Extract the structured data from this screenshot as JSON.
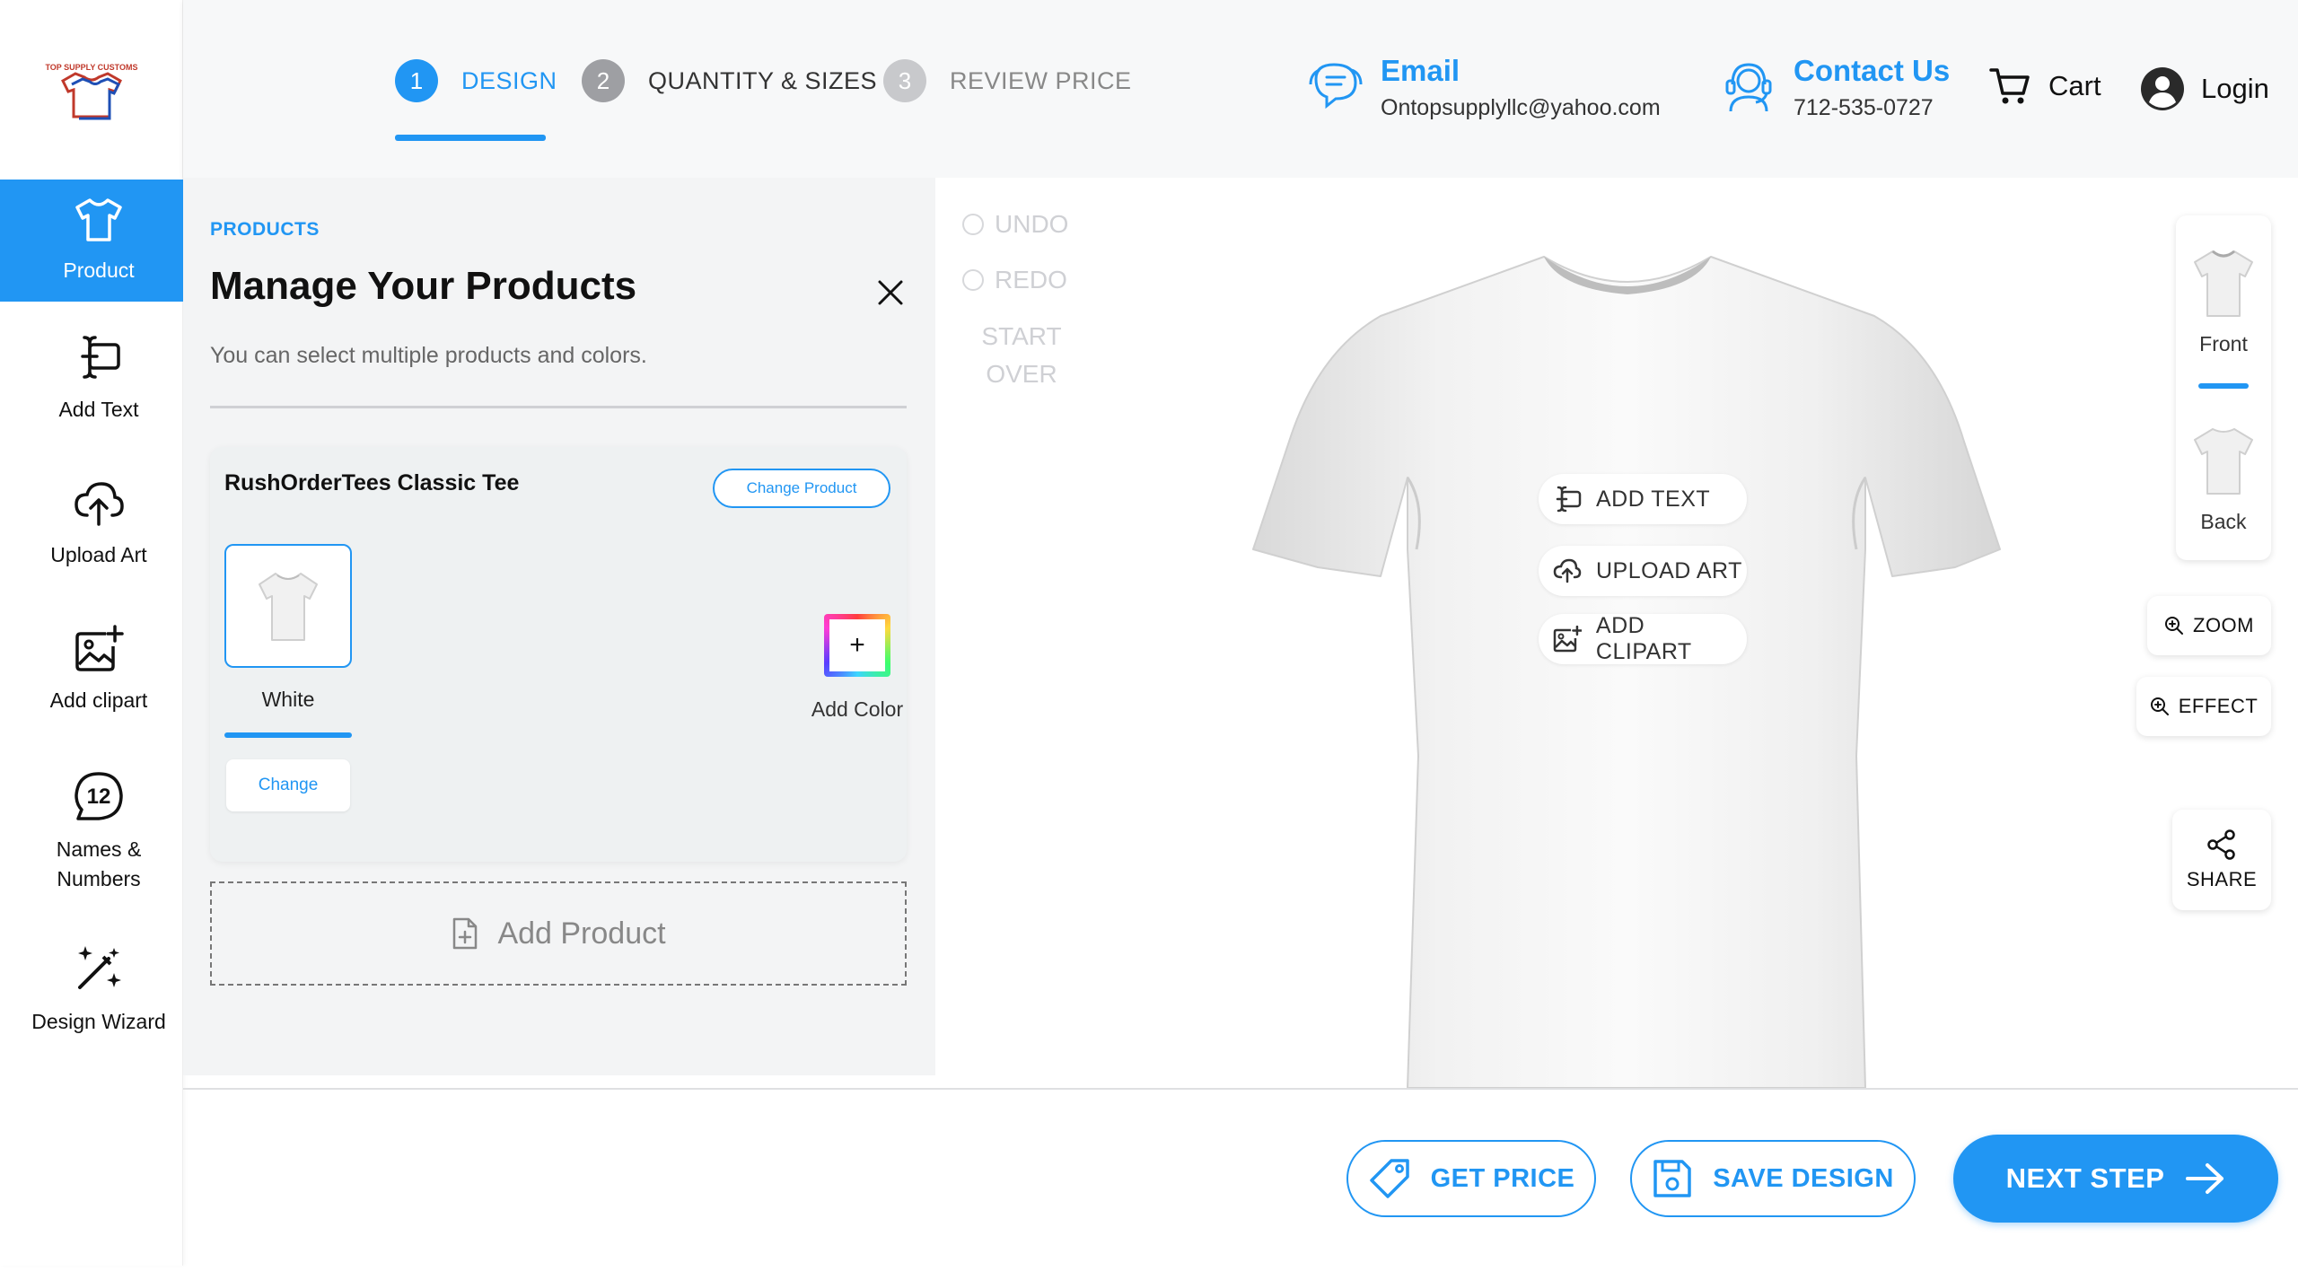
{
  "brand": {
    "logo_text": "TOP SUPPLY CUSTOMS"
  },
  "steps": [
    {
      "num": "1",
      "label": "DESIGN",
      "state": "active"
    },
    {
      "num": "2",
      "label": "QUANTITY & SIZES",
      "state": "inactive"
    },
    {
      "num": "3",
      "label": "REVIEW PRICE",
      "state": "inactive"
    }
  ],
  "header": {
    "email": {
      "title": "Email",
      "value": "Ontopsupplyllc@yahoo.com",
      "icon": "chat-support-icon"
    },
    "contact": {
      "title": "Contact Us",
      "value": "712-535-0727",
      "icon": "headset-icon"
    },
    "cart_label": "Cart",
    "login_label": "Login"
  },
  "sidebar": {
    "items": [
      {
        "label": "Product",
        "icon": "tshirt-icon",
        "active": true
      },
      {
        "label": "Add Text",
        "icon": "text-cursor-icon"
      },
      {
        "label": "Upload Art",
        "icon": "cloud-upload-icon"
      },
      {
        "label": "Add clipart",
        "icon": "image-add-icon"
      },
      {
        "label": "Names & Numbers",
        "icon": "number-badge-icon",
        "badge": "12"
      },
      {
        "label": "Design Wizard",
        "icon": "magic-wand-icon"
      }
    ]
  },
  "panel": {
    "kicker": "PRODUCTS",
    "title": "Manage Your Products",
    "hint": "You can select multiple products and colors.",
    "product": {
      "name": "RushOrderTees Classic Tee",
      "change_product_label": "Change Product",
      "color_name": "White",
      "change_label": "Change",
      "add_color_label": "Add Color",
      "add_color_symbol": "+"
    },
    "add_product_label": "Add Product"
  },
  "history": {
    "undo": "UNDO",
    "redo": "REDO",
    "start_over": "START OVER"
  },
  "overlay": {
    "add_text": "ADD TEXT",
    "upload_art": "UPLOAD ART",
    "add_clipart": "ADD CLIPART"
  },
  "views": {
    "front": "Front",
    "back": "Back",
    "zoom": "ZOOM",
    "effect": "EFFECT",
    "share": "SHARE"
  },
  "footer": {
    "get_price": "GET PRICE",
    "save_design": "SAVE DESIGN",
    "next_step": "NEXT STEP"
  },
  "colors": {
    "accent": "#2196f3",
    "text": "#111111",
    "muted": "#888888",
    "panel_bg": "#f3f4f5"
  }
}
